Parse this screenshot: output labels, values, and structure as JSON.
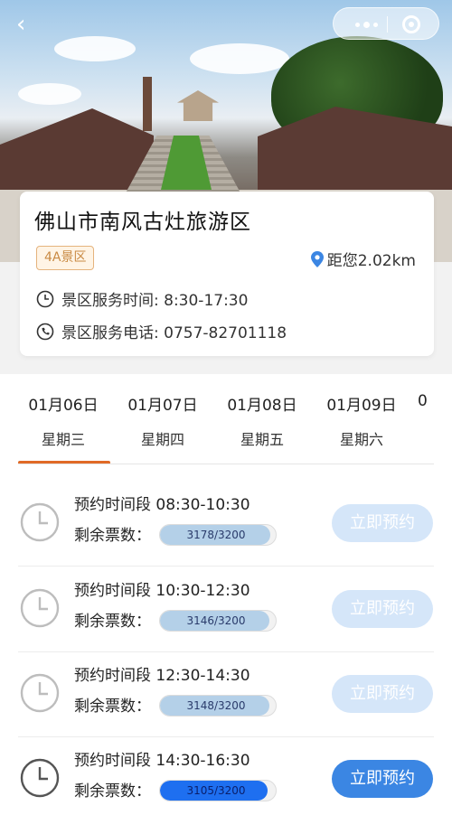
{
  "header": {
    "back_glyph": "‹"
  },
  "scenic": {
    "name": "佛山市南风古灶旅游区",
    "badge": "4A景区",
    "distance": "距您2.02km",
    "service_hours": "景区服务时间: 8:30-17:30",
    "service_phone": "景区服务电话: 0757-82701118"
  },
  "dates": [
    {
      "date": "01月06日",
      "weekday": "星期三"
    },
    {
      "date": "01月07日",
      "weekday": "星期四"
    },
    {
      "date": "01月08日",
      "weekday": "星期五"
    },
    {
      "date": "01月09日",
      "weekday": "星期六"
    },
    {
      "date": "0",
      "weekday": ""
    }
  ],
  "slots": [
    {
      "time": "预约时间段 08:30-10:30",
      "remain_label": "剩余票数：",
      "tickets": "3178/3200",
      "remaining": 3178,
      "total": 3200,
      "button": "立即预约",
      "enabled": false
    },
    {
      "time": "预约时间段 10:30-12:30",
      "remain_label": "剩余票数：",
      "tickets": "3146/3200",
      "remaining": 3146,
      "total": 3200,
      "button": "立即预约",
      "enabled": false
    },
    {
      "time": "预约时间段 12:30-14:30",
      "remain_label": "剩余票数：",
      "tickets": "3148/3200",
      "remaining": 3148,
      "total": 3200,
      "button": "立即预约",
      "enabled": false
    },
    {
      "time": "预约时间段 14:30-16:30",
      "remain_label": "剩余票数：",
      "tickets": "3105/3200",
      "remaining": 3105,
      "total": 3200,
      "button": "立即预约",
      "enabled": true
    }
  ],
  "colors": {
    "accent_orange": "#e06a26",
    "button_active": "#3b86e3",
    "button_disabled": "#d5e6f9",
    "bar_active": "#1e6ff0",
    "bar_inactive": "#b4d0e8"
  }
}
